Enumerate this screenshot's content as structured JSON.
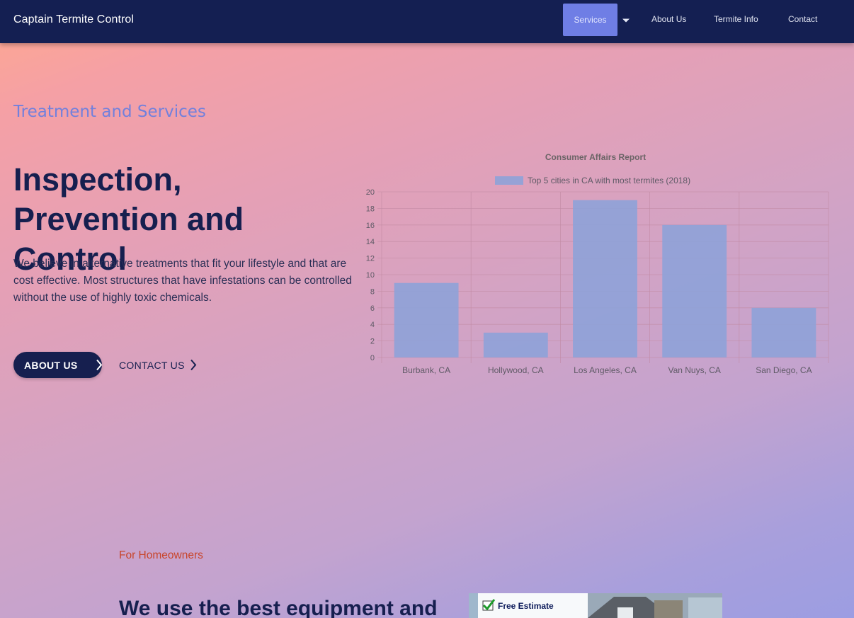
{
  "nav": {
    "brand": "Captain Termite Control",
    "items": [
      {
        "label": "Services"
      },
      {
        "label": "About Us"
      },
      {
        "label": "Termite Info"
      },
      {
        "label": "Contact"
      }
    ]
  },
  "hero": {
    "eyebrow": "Treatment and Services",
    "title": "Inspection, Prevention and Control",
    "body": "We believe in alternative treatments that fit your lifestyle and that are cost effective. Most structures that have infestations can be controlled without the use of highly toxic chemicals.",
    "primary_cta": "ABOUT US",
    "secondary_cta": "CONTACT US"
  },
  "chart_data": {
    "type": "bar",
    "title": "Consumer Affairs Report",
    "categories": [
      "Burbank, CA",
      "Hollywood, CA",
      "Los Angeles, CA",
      "Van Nuys, CA",
      "San Diego, CA"
    ],
    "series": [
      {
        "name": "Top 5 cities in CA with most termites (2018)",
        "values": [
          9,
          3,
          19,
          16,
          6
        ]
      }
    ],
    "ylim": [
      0,
      20
    ],
    "yticks": [
      0,
      2,
      4,
      6,
      8,
      10,
      12,
      14,
      16,
      18,
      20
    ],
    "grid": true,
    "legend": "top",
    "bar_color": "#8ea2d8",
    "grid_color": "#c28aa3"
  },
  "section2": {
    "eyebrow": "For Homeowners",
    "title": "We use the best equipment and",
    "image_caption": "Free Estimate"
  },
  "colors": {
    "nav_bg": "#141f52",
    "accent": "#6f7ee5",
    "heading": "#161f4f",
    "eyebrow_orange": "#c8452b"
  }
}
